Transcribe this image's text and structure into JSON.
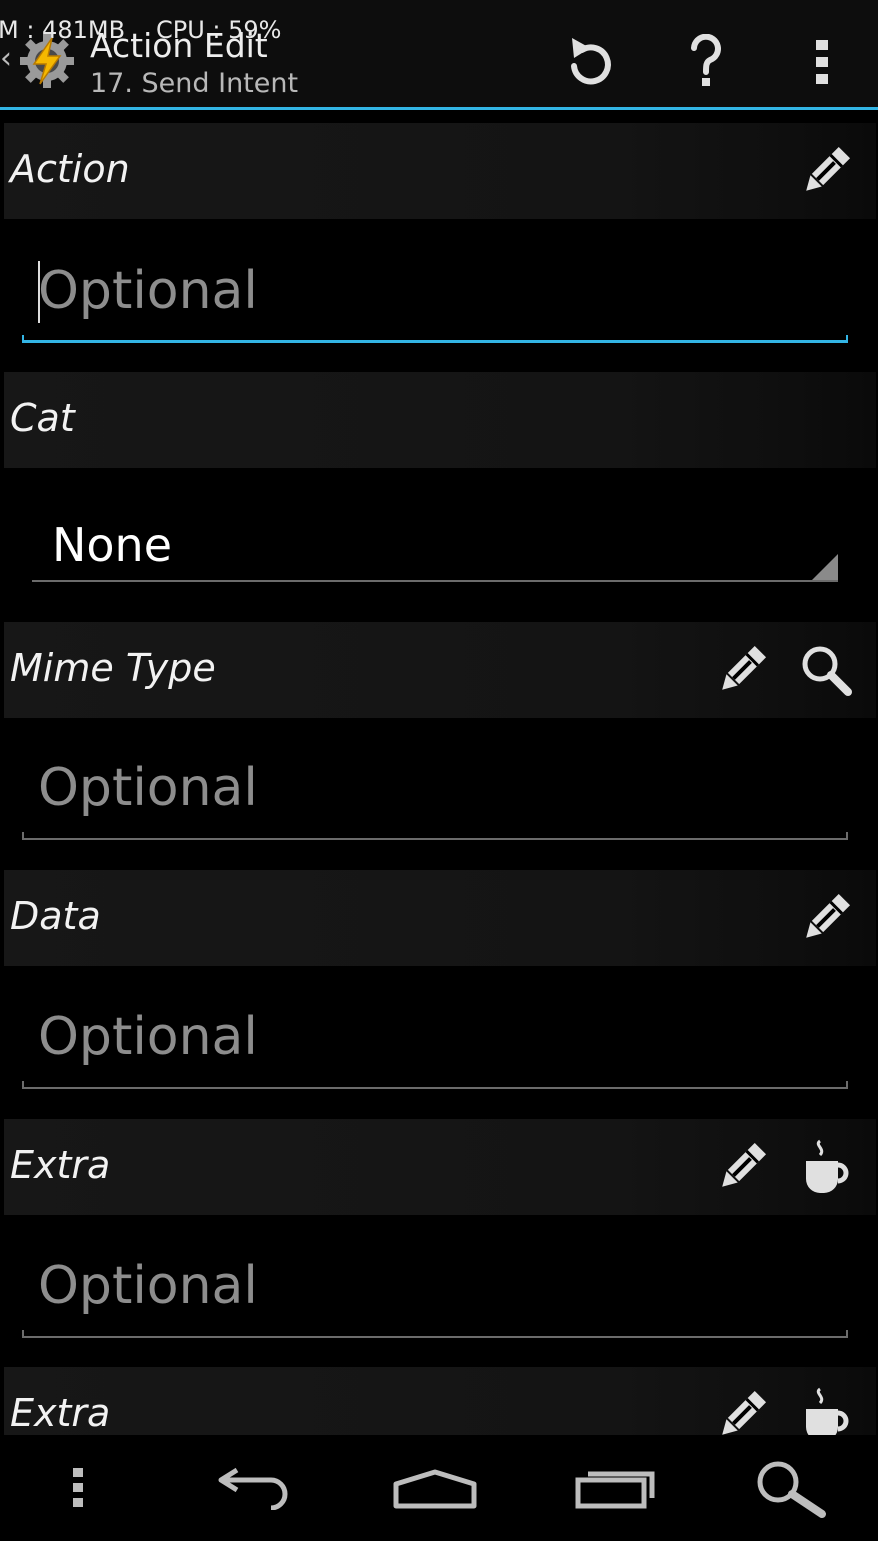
{
  "status": {
    "memory": "M : 481MB",
    "cpu": "CPU : 59%"
  },
  "actionbar": {
    "title": "Action Edit",
    "subtitle": "17. Send Intent",
    "app_icon": "tasker-gear-bolt-icon",
    "buttons": [
      {
        "name": "revert",
        "icon": "refresh-icon"
      },
      {
        "name": "help",
        "icon": "help-icon"
      },
      {
        "name": "overflow",
        "icon": "overflow-menu-icon"
      }
    ],
    "accent_color": "#33b5e5"
  },
  "sections": {
    "action": {
      "label": "Action",
      "placeholder": "Optional",
      "value": ""
    },
    "cat": {
      "label": "Cat",
      "selected": "None"
    },
    "mime_type": {
      "label": "Mime Type",
      "placeholder": "Optional",
      "value": ""
    },
    "data": {
      "label": "Data",
      "placeholder": "Optional",
      "value": ""
    },
    "extra1": {
      "label": "Extra",
      "placeholder": "Optional",
      "value": ""
    },
    "extra2": {
      "label": "Extra"
    }
  },
  "navbar": {
    "buttons": [
      "menu-icon",
      "back-icon",
      "home-icon",
      "recents-icon",
      "search-icon"
    ]
  }
}
